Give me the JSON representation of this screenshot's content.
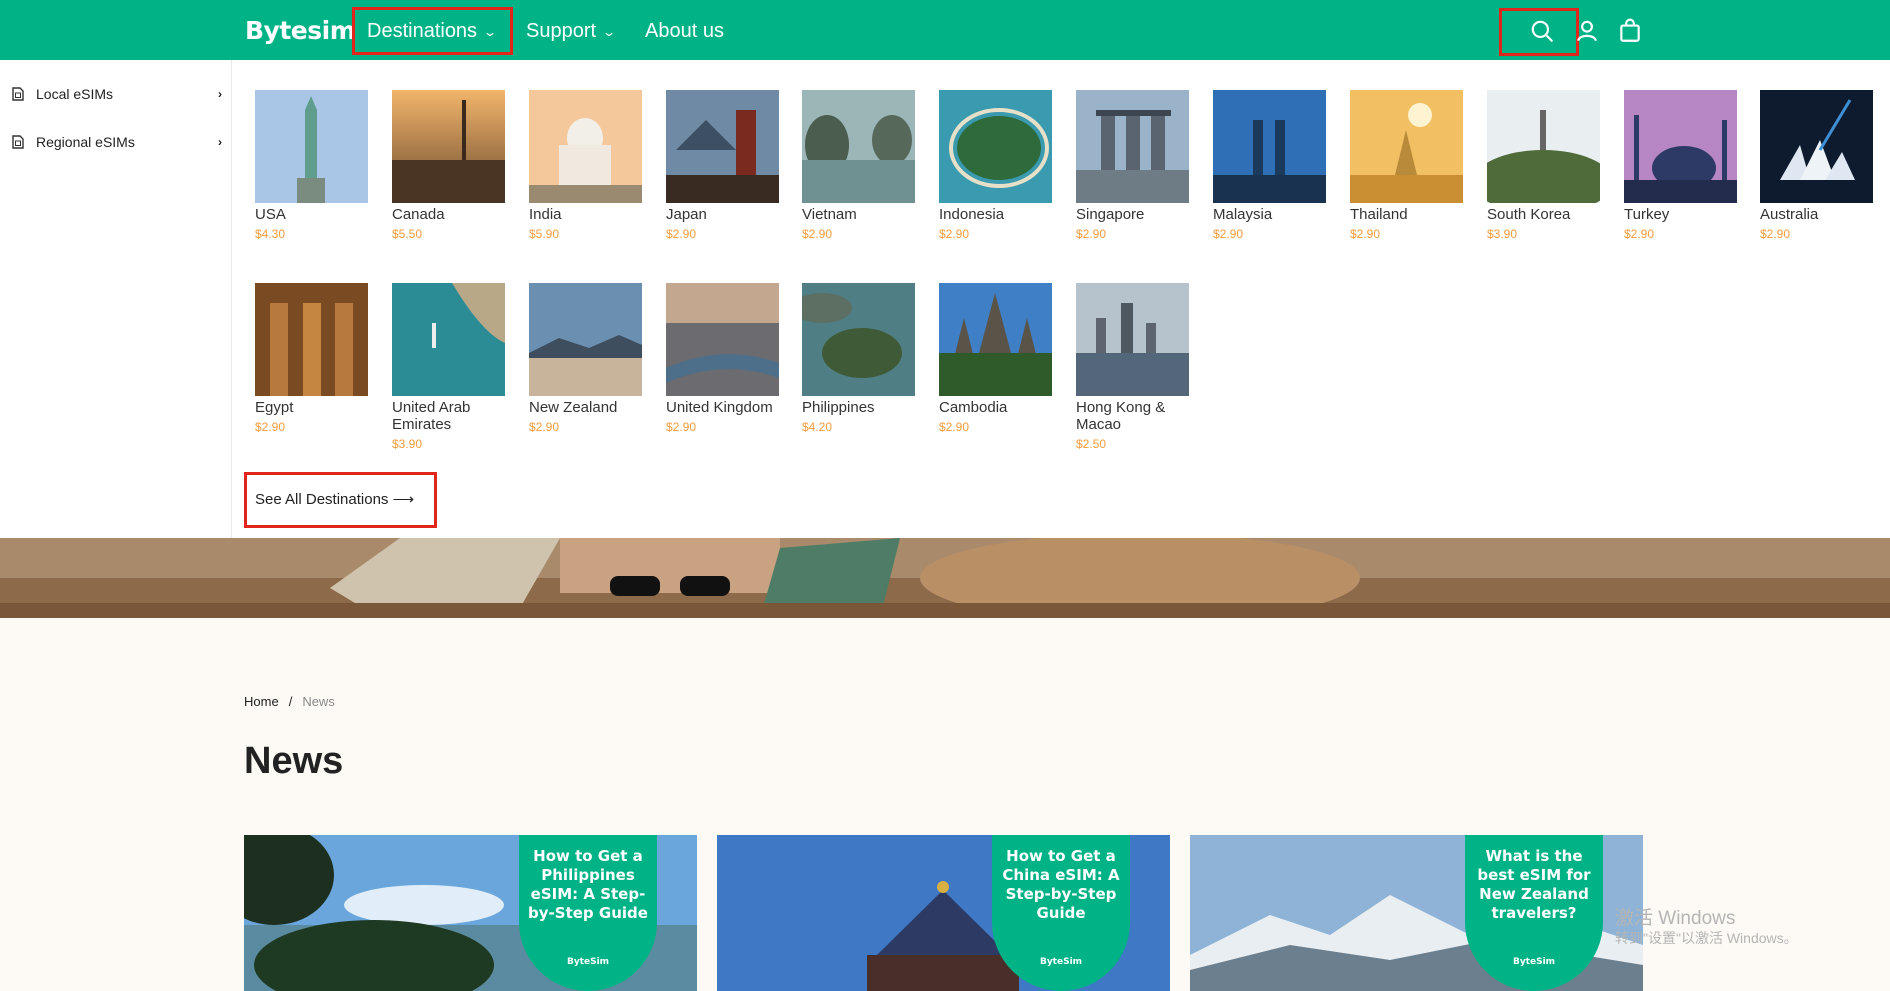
{
  "header": {
    "logo": "Bytesim",
    "nav": [
      {
        "label": "Destinations",
        "chevron": "chevron-down-icon"
      },
      {
        "label": "Support",
        "chevron": "chevron-down-icon"
      },
      {
        "label": "About us"
      }
    ],
    "icons": [
      "search-icon",
      "user-icon",
      "bag-icon"
    ],
    "colors": {
      "brand": "#00b386",
      "highlight": "#e0251b",
      "price": "#f39c3c"
    }
  },
  "sidebar": {
    "items": [
      {
        "label": "Local eSIMs",
        "icon": "sim-icon"
      },
      {
        "label": "Regional eSIMs",
        "icon": "sim-icon"
      }
    ]
  },
  "destinations": [
    {
      "name": "USA",
      "price": "$4.30"
    },
    {
      "name": "Canada",
      "price": "$5.50"
    },
    {
      "name": "India",
      "price": "$5.90"
    },
    {
      "name": "Japan",
      "price": "$2.90"
    },
    {
      "name": "Vietnam",
      "price": "$2.90"
    },
    {
      "name": "Indonesia",
      "price": "$2.90"
    },
    {
      "name": "Singapore",
      "price": "$2.90"
    },
    {
      "name": "Malaysia",
      "price": "$2.90"
    },
    {
      "name": "Thailand",
      "price": "$2.90"
    },
    {
      "name": "South Korea",
      "price": "$3.90"
    },
    {
      "name": "Turkey",
      "price": "$2.90"
    },
    {
      "name": "Australia",
      "price": "$2.90"
    },
    {
      "name": "Egypt",
      "price": "$2.90"
    },
    {
      "name": "United Arab Emirates",
      "price": "$3.90"
    },
    {
      "name": "New Zealand",
      "price": "$2.90"
    },
    {
      "name": "United Kingdom",
      "price": "$2.90"
    },
    {
      "name": "Philippines",
      "price": "$4.20"
    },
    {
      "name": "Cambodia",
      "price": "$2.90"
    },
    {
      "name": "Hong Kong & Macao",
      "price": "$2.50"
    }
  ],
  "see_all": "See All Destinations ⟶",
  "breadcrumb": {
    "home": "Home",
    "sep": "/",
    "current": "News"
  },
  "news": {
    "title": "News",
    "cards": [
      {
        "tag": "How to Get a Philippines eSIM: A Step-by-Step Guide",
        "brand": "ByteSim"
      },
      {
        "tag": "How to Get a China eSIM: A Step-by-Step Guide",
        "brand": "ByteSim"
      },
      {
        "tag": "What is the best eSIM for New Zealand travelers?",
        "brand": "ByteSim"
      }
    ]
  },
  "watermark": {
    "line1": "激活 Windows",
    "line2": "转到\"设置\"以激活 Windows。"
  }
}
